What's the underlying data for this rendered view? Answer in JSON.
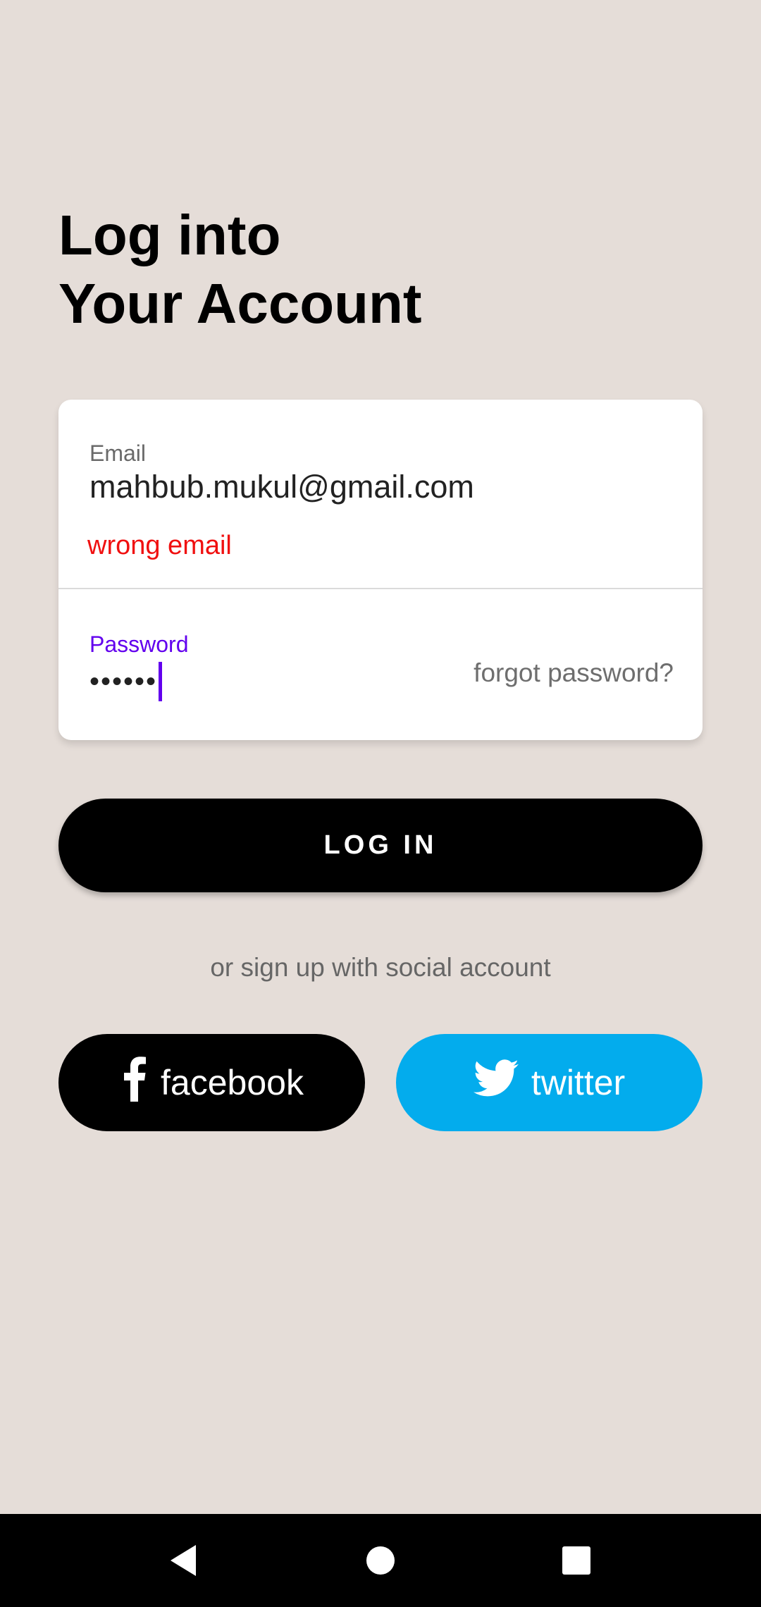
{
  "title": {
    "line1": "Log into",
    "line2": "Your Account"
  },
  "email": {
    "label": "Email",
    "value": "mahbub.mukul@gmail.com",
    "error": "wrong email",
    "error_color": "#f01010"
  },
  "password": {
    "label": "Password",
    "value": "••••••",
    "forgot_label": "forgot password?",
    "focus_color": "#6200ee"
  },
  "login_button": {
    "label": "LOG IN"
  },
  "social": {
    "hint": "or sign up with social account",
    "facebook_label": "facebook",
    "twitter_label": "twitter",
    "facebook_icon": "facebook-icon",
    "twitter_icon": "twitter-icon",
    "twitter_color": "#03aced"
  },
  "colors": {
    "background": "#e5ddd8",
    "button": "#000000"
  },
  "nav": {
    "back_icon": "back-icon",
    "home_icon": "home-icon",
    "recent_icon": "recent-apps-icon"
  }
}
